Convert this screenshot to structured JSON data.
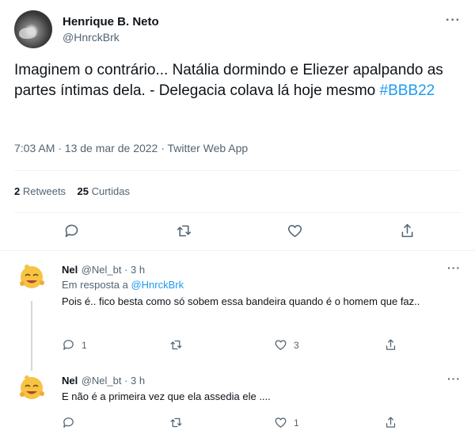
{
  "tweet": {
    "author_name": "Henrique B. Neto",
    "author_handle": "@HnrckBrk",
    "text_main": "Imaginem o contrário... Natália dormindo e Eliezer apalpando as partes íntimas dela. - Delegacia colava lá hoje mesmo ",
    "hashtag": "#BBB22",
    "timestamp": "7:03 AM · 13 de mar de 2022 · Twitter Web App",
    "retweets_count": "2",
    "retweets_label": "Retweets",
    "likes_count": "25",
    "likes_label": "Curtidas",
    "more_icon": "···"
  },
  "replies": [
    {
      "name": "Nel",
      "handle_time": "@Nel_bt · 3 h",
      "reply_to_prefix": "Em resposta a ",
      "reply_to_mention": "@HnrckBrk",
      "text": "Pois é.. fico besta como só sobem essa bandeira quando é o homem que faz..",
      "reply_count": "1",
      "like_count": "3",
      "more_icon": "···"
    },
    {
      "name": "Nel",
      "handle_time": "@Nel_bt · 3 h",
      "text": "E não é a primeira vez que ela assedia ele ....",
      "reply_count": "",
      "like_count": "1",
      "more_icon": "···"
    }
  ],
  "colors": {
    "accent": "#1d9bf0",
    "muted": "#536471",
    "divider": "#eff3f4"
  },
  "icons": [
    "reply-icon",
    "retweet-icon",
    "like-icon",
    "share-icon",
    "more-icon",
    "emoji-avatar-icon"
  ]
}
